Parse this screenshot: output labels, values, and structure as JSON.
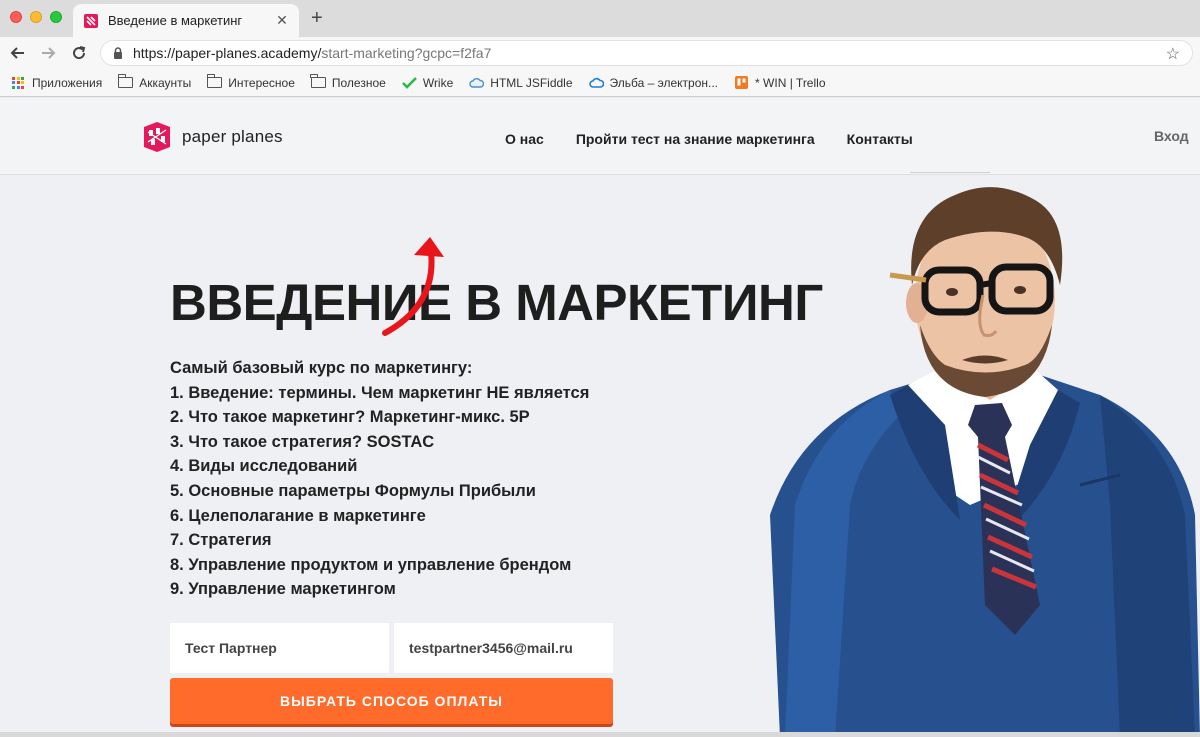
{
  "browser": {
    "tab_title": "Введение в маркетинг",
    "tab_close": "✕",
    "new_tab": "+",
    "url_host": "https://paper-planes.academy/",
    "url_path": "start-marketing?gcpc=f2fa7",
    "bookmarks": [
      {
        "label": "Приложения",
        "icon": "apps-grid-icon"
      },
      {
        "label": "Аккаунты",
        "icon": "folder-icon"
      },
      {
        "label": "Интересное",
        "icon": "folder-icon"
      },
      {
        "label": "Полезное",
        "icon": "folder-icon"
      },
      {
        "label": "Wrike",
        "icon": "checkmark-icon"
      },
      {
        "label": "HTML JSFiddle",
        "icon": "cloud-icon"
      },
      {
        "label": "Эльба – электрон...",
        "icon": "cloud-icon"
      },
      {
        "label": "* WIN | Trello",
        "icon": "trello-icon"
      }
    ]
  },
  "site": {
    "logo_text": "paper planes",
    "nav": [
      "О нас",
      "Пройти тест на знание маркетинга",
      "Контакты"
    ],
    "login": "Вход"
  },
  "hero": {
    "headline": "ВВЕДЕНИЕ В МАРКЕТИНГ",
    "intro": "Самый базовый курс по маркетингу:",
    "items": [
      "1. Введение: термины. Чем маркетинг НЕ является",
      "2. Что такое маркетинг? Маркетинг-микс. 5P",
      "3. Что такое стратегия? SOSTAC",
      "4. Виды исследований",
      "5. Основные параметры Формулы Прибыли",
      "6. Целеполагание в маркетинге",
      "7. Стратегия",
      "8. Управление продуктом и управление брендом",
      "9. Управление маркетингом"
    ],
    "name_value": "Тест Партнер",
    "email_value": "testpartner3456@mail.ru",
    "pay_button": "ВЫБРАТЬ СПОСОБ ОПЛАТЫ"
  },
  "colors": {
    "accent_orange": "#ff6b2b",
    "brand_pink": "#e4185a",
    "annotation_arrow": "#e8161b"
  }
}
